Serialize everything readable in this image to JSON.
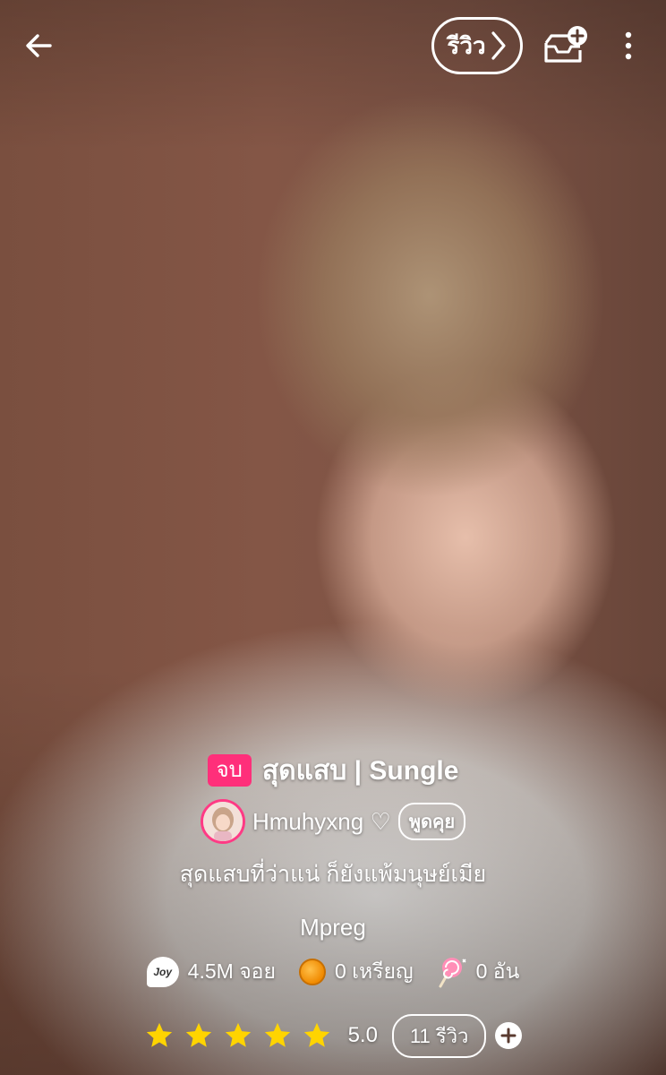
{
  "header": {
    "review_label": "รีวิว",
    "icons": [
      "back-arrow-icon",
      "chevron-right-icon",
      "library-add-icon",
      "more-vertical-icon"
    ]
  },
  "story": {
    "status": "จบ",
    "title": "สุดแสบ | Sungle",
    "author": "Hmuhyxng ♡",
    "talk_label": "พูดคุย",
    "tagline": "สุดแสบที่ว่าแน่ ก็ยังแพ้มนุษย์เมีย",
    "genre": "Mpreg"
  },
  "stats": {
    "joy_icon_text": "Joy",
    "reads": "4.5M จอย",
    "coins": "0 เหรียญ",
    "candies": "0 อัน"
  },
  "rating": {
    "stars": 5,
    "value": "5.0",
    "review_count": "11 รีวิว"
  },
  "colors": {
    "accent": "#ff2f7a",
    "star": "#ffd400",
    "coin": "#f08a00"
  }
}
